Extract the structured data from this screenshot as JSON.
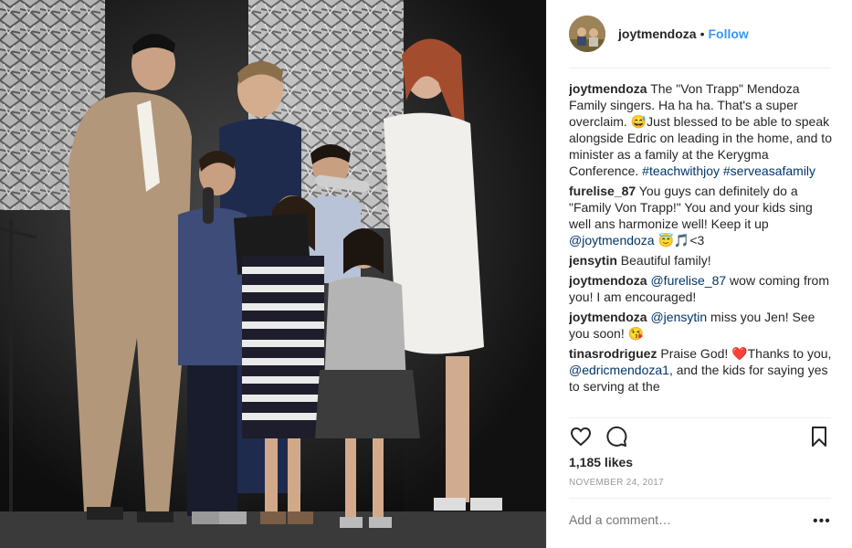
{
  "post": {
    "username": "joytmendoza",
    "separator": "•",
    "follow_label": "Follow",
    "avatar_icon": "user-avatar",
    "likes": "1,185 likes",
    "date": "NOVEMBER 24, 2017",
    "comment_placeholder": "Add a comment…",
    "more_label": "•••"
  },
  "caption": {
    "user": "joytmendoza",
    "text": " The \"Von Trapp\" Mendoza Family singers. Ha ha ha. That's a super overclaim. 😅Just blessed to be able to speak alongside Edric on leading in the home, and to minister as a family at the Kerygma Conference. ",
    "tag1": "#teachwithjoy",
    "tag2": "#serveasafamily"
  },
  "comments": [
    {
      "user": "furelise_87",
      "text": " You guys can definitely do a \"Family Von Trapp!\" You and your kids sing well ans harmonize well! Keep it up ",
      "mention": "@joytmendoza",
      "after": " 😇🎵<3"
    },
    {
      "user": "jensytin",
      "text": " Beautiful family!"
    },
    {
      "user": "joytmendoza",
      "mention": " @furelise_87",
      "text": " wow coming from you! I am encouraged!"
    },
    {
      "user": "joytmendoza",
      "mention": " @jensytin",
      "text": " miss you Jen! See you soon! 😘"
    },
    {
      "user": "tinasrodriguez",
      "text": " Praise God! ❤️Thanks to you, ",
      "mention": "@edricmendoza1",
      "after": ", and the kids for saying yes to serving at the"
    }
  ],
  "icons": {
    "like": "heart-icon",
    "comment": "comment-icon",
    "save": "bookmark-icon"
  },
  "colors": {
    "link": "#3897f0",
    "tag": "#003569",
    "muted": "#999999"
  }
}
